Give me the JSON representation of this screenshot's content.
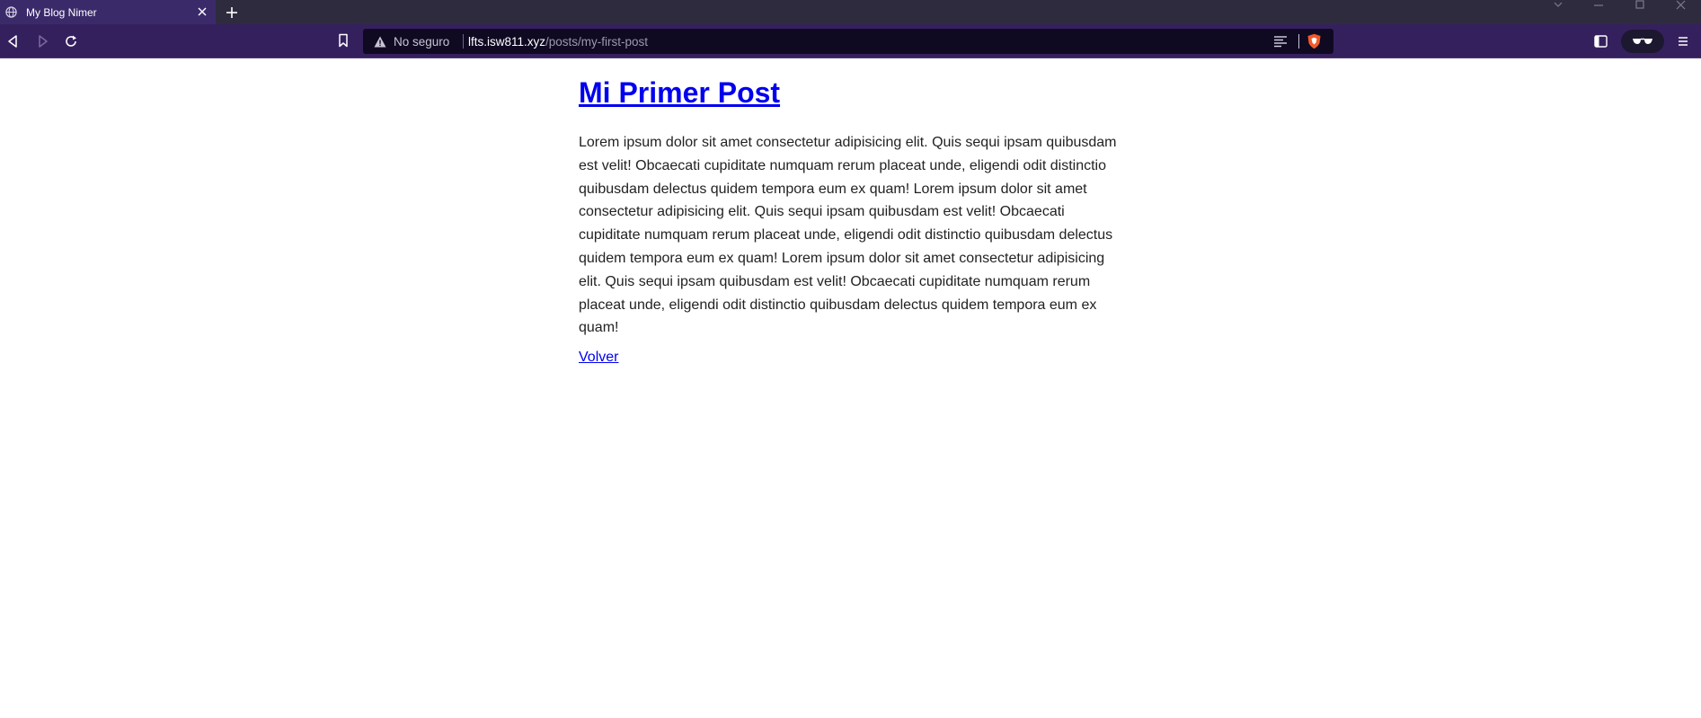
{
  "browser": {
    "tab": {
      "title": "My Blog Nimer",
      "favicon_icon": "globe-icon",
      "close_icon": "close-icon"
    },
    "new_tab_icon": "plus-icon",
    "window_controls": [
      "chevron-down-icon",
      "minimize-icon",
      "maximize-icon",
      "close-icon"
    ],
    "nav": {
      "back_icon": "back-icon",
      "forward_icon": "forward-icon",
      "reload_icon": "reload-icon",
      "bookmark_icon": "bookmark-icon"
    },
    "urlbar": {
      "security_label": "No seguro",
      "host": "lfts.isw811.xyz",
      "path": "/posts/my-first-post",
      "reader_icon": "reader-mode-icon",
      "shield_icon": "brave-shield-icon"
    },
    "right_tools": [
      "sidebar-icon",
      "wallet-icon",
      "menu-icon"
    ],
    "colors": {
      "tab_strip": "#2f2b3e",
      "toolbar": "#35205e",
      "urlbar": "#0f0a22",
      "link": "#0000ee"
    }
  },
  "post": {
    "title": "Mi Primer Post",
    "body": "Lorem ipsum dolor sit amet consectetur adipisicing elit. Quis sequi ipsam quibusdam est velit! Obcaecati cupiditate numquam rerum placeat unde, eligendi odit distinctio quibusdam delectus quidem tempora eum ex quam! Lorem ipsum dolor sit amet consectetur adipisicing elit. Quis sequi ipsam quibusdam est velit! Obcaecati cupiditate numquam rerum placeat unde, eligendi odit distinctio quibusdam delectus quidem tempora eum ex quam! Lorem ipsum dolor sit amet consectetur adipisicing elit. Quis sequi ipsam quibusdam est velit! Obcaecati cupiditate numquam rerum placeat unde, eligendi odit distinctio quibusdam delectus quidem tempora eum ex quam!",
    "back_label": "Volver"
  }
}
